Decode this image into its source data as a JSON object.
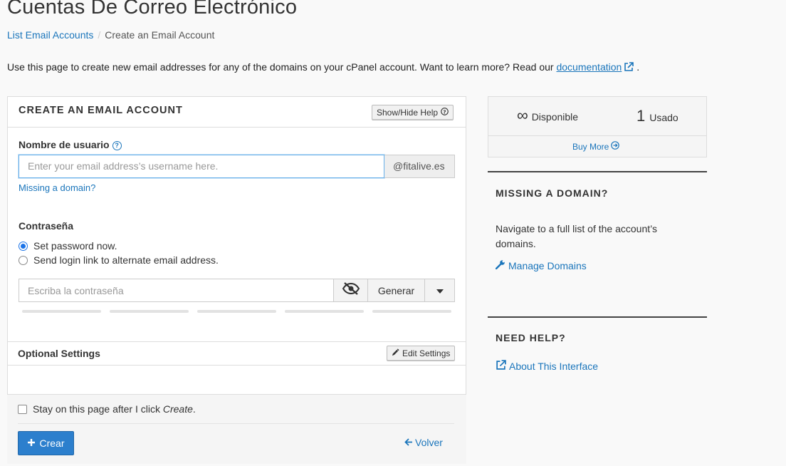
{
  "page": {
    "title": "Cuentas De Correo Electrónico",
    "breadcrumb": {
      "link": "List Email Accounts",
      "current": "Create an Email Account"
    },
    "intro_text": "Use this page to create new email addresses for any of the domains on your cPanel account. Want to learn more? Read our",
    "intro_link": "documentation",
    "intro_end": "."
  },
  "form": {
    "panel_title": "CREATE AN EMAIL ACCOUNT",
    "show_hide_help": "Show/Hide Help",
    "username_label": "Nombre de usuario",
    "username_placeholder": "Enter your email address’s username here.",
    "domain_addon": "@fitalive.es",
    "missing_domain_link": "Missing a domain?",
    "password_label": "Contraseña",
    "radio_set_password": "Set password now.",
    "radio_send_link": "Send login link to alternate email address.",
    "radio_selected": "set_password",
    "password_placeholder": "Escriba la contraseña",
    "generate_button": "Generar",
    "strength_segments": 5,
    "optional_settings_label": "Optional Settings",
    "edit_settings_button": "Edit Settings",
    "stay_on_page_prefix": "Stay on this page after I click",
    "stay_on_page_em": "Create",
    "stay_on_page_suffix": ".",
    "stay_on_page_checked": false,
    "create_button": "Crear",
    "back_link": "Volver"
  },
  "sidebar": {
    "available_value": "∞",
    "available_label": "Disponible",
    "used_value": "1",
    "used_label": "Usado",
    "buy_more": "Buy More",
    "missing_domain_title": "MISSING A DOMAIN?",
    "missing_domain_text": "Navigate to a full list of the account’s domains.",
    "manage_domains_link": "Manage Domains",
    "need_help_title": "NEED HELP?",
    "about_interface_link": "About This Interface"
  },
  "colors": {
    "link": "#1a75bb",
    "primary": "#2c7fcd",
    "radio_selected": "#1a73e8"
  }
}
